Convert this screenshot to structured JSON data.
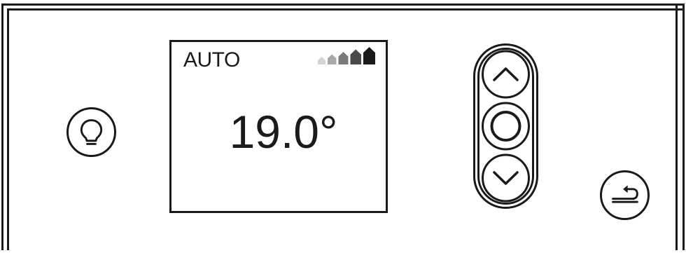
{
  "display": {
    "mode": "AUTO",
    "temperature": "19.0°",
    "signal_level": 5,
    "signal_bars": 5
  },
  "buttons": {
    "light": "lightbulb-icon",
    "up": "chevron-up-icon",
    "ok": "circle-icon",
    "down": "chevron-down-icon",
    "back": "return-arrow-icon"
  },
  "colors": {
    "ink": "#1a1a1a",
    "signal_active": "#1a1a1a",
    "signal_faded": "#bdbdbd"
  }
}
